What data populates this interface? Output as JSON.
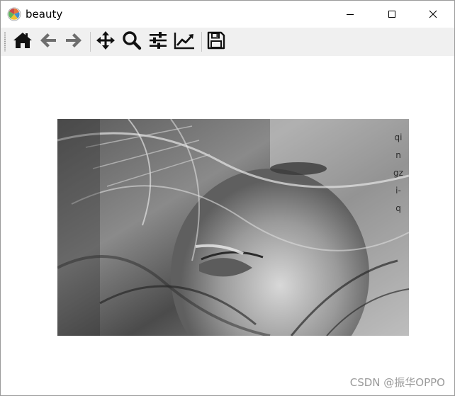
{
  "window": {
    "title": "beauty",
    "app_icon": "matplotlib-icon",
    "controls": {
      "minimize_icon": "minimize-icon",
      "maximize_icon": "maximize-icon",
      "close_icon": "close-icon"
    }
  },
  "toolbar": {
    "items": [
      {
        "name": "home",
        "icon": "home-icon"
      },
      {
        "name": "back",
        "icon": "arrow-left-icon"
      },
      {
        "name": "forward",
        "icon": "arrow-right-icon"
      },
      {
        "name": "pan",
        "icon": "move-icon"
      },
      {
        "name": "zoom",
        "icon": "zoom-icon"
      },
      {
        "name": "subplots",
        "icon": "sliders-icon"
      },
      {
        "name": "customize",
        "icon": "line-chart-icon"
      },
      {
        "name": "save",
        "icon": "floppy-disk-icon"
      }
    ]
  },
  "figure": {
    "image_description_text": "qingzi-q",
    "photo_colors": {
      "dark": "#1f1f1f",
      "mid": "#7d7d7d",
      "light": "#e6e6e6"
    }
  },
  "watermark": "CSDN @振华OPPO"
}
